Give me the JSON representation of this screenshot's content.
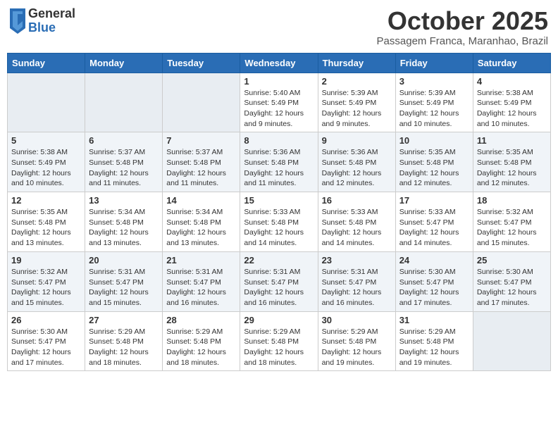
{
  "header": {
    "logo_general": "General",
    "logo_blue": "Blue",
    "month": "October 2025",
    "location": "Passagem Franca, Maranhao, Brazil"
  },
  "days_of_week": [
    "Sunday",
    "Monday",
    "Tuesday",
    "Wednesday",
    "Thursday",
    "Friday",
    "Saturday"
  ],
  "weeks": [
    [
      {
        "day": "",
        "empty": true
      },
      {
        "day": "",
        "empty": true
      },
      {
        "day": "",
        "empty": true
      },
      {
        "day": "1",
        "sunrise": "5:40 AM",
        "sunset": "5:49 PM",
        "daylight": "12 hours and 9 minutes."
      },
      {
        "day": "2",
        "sunrise": "5:39 AM",
        "sunset": "5:49 PM",
        "daylight": "12 hours and 9 minutes."
      },
      {
        "day": "3",
        "sunrise": "5:39 AM",
        "sunset": "5:49 PM",
        "daylight": "12 hours and 10 minutes."
      },
      {
        "day": "4",
        "sunrise": "5:38 AM",
        "sunset": "5:49 PM",
        "daylight": "12 hours and 10 minutes."
      }
    ],
    [
      {
        "day": "5",
        "sunrise": "5:38 AM",
        "sunset": "5:49 PM",
        "daylight": "12 hours and 10 minutes."
      },
      {
        "day": "6",
        "sunrise": "5:37 AM",
        "sunset": "5:48 PM",
        "daylight": "12 hours and 11 minutes."
      },
      {
        "day": "7",
        "sunrise": "5:37 AM",
        "sunset": "5:48 PM",
        "daylight": "12 hours and 11 minutes."
      },
      {
        "day": "8",
        "sunrise": "5:36 AM",
        "sunset": "5:48 PM",
        "daylight": "12 hours and 11 minutes."
      },
      {
        "day": "9",
        "sunrise": "5:36 AM",
        "sunset": "5:48 PM",
        "daylight": "12 hours and 12 minutes."
      },
      {
        "day": "10",
        "sunrise": "5:35 AM",
        "sunset": "5:48 PM",
        "daylight": "12 hours and 12 minutes."
      },
      {
        "day": "11",
        "sunrise": "5:35 AM",
        "sunset": "5:48 PM",
        "daylight": "12 hours and 12 minutes."
      }
    ],
    [
      {
        "day": "12",
        "sunrise": "5:35 AM",
        "sunset": "5:48 PM",
        "daylight": "12 hours and 13 minutes."
      },
      {
        "day": "13",
        "sunrise": "5:34 AM",
        "sunset": "5:48 PM",
        "daylight": "12 hours and 13 minutes."
      },
      {
        "day": "14",
        "sunrise": "5:34 AM",
        "sunset": "5:48 PM",
        "daylight": "12 hours and 13 minutes."
      },
      {
        "day": "15",
        "sunrise": "5:33 AM",
        "sunset": "5:48 PM",
        "daylight": "12 hours and 14 minutes."
      },
      {
        "day": "16",
        "sunrise": "5:33 AM",
        "sunset": "5:48 PM",
        "daylight": "12 hours and 14 minutes."
      },
      {
        "day": "17",
        "sunrise": "5:33 AM",
        "sunset": "5:47 PM",
        "daylight": "12 hours and 14 minutes."
      },
      {
        "day": "18",
        "sunrise": "5:32 AM",
        "sunset": "5:47 PM",
        "daylight": "12 hours and 15 minutes."
      }
    ],
    [
      {
        "day": "19",
        "sunrise": "5:32 AM",
        "sunset": "5:47 PM",
        "daylight": "12 hours and 15 minutes."
      },
      {
        "day": "20",
        "sunrise": "5:31 AM",
        "sunset": "5:47 PM",
        "daylight": "12 hours and 15 minutes."
      },
      {
        "day": "21",
        "sunrise": "5:31 AM",
        "sunset": "5:47 PM",
        "daylight": "12 hours and 16 minutes."
      },
      {
        "day": "22",
        "sunrise": "5:31 AM",
        "sunset": "5:47 PM",
        "daylight": "12 hours and 16 minutes."
      },
      {
        "day": "23",
        "sunrise": "5:31 AM",
        "sunset": "5:47 PM",
        "daylight": "12 hours and 16 minutes."
      },
      {
        "day": "24",
        "sunrise": "5:30 AM",
        "sunset": "5:47 PM",
        "daylight": "12 hours and 17 minutes."
      },
      {
        "day": "25",
        "sunrise": "5:30 AM",
        "sunset": "5:47 PM",
        "daylight": "12 hours and 17 minutes."
      }
    ],
    [
      {
        "day": "26",
        "sunrise": "5:30 AM",
        "sunset": "5:47 PM",
        "daylight": "12 hours and 17 minutes."
      },
      {
        "day": "27",
        "sunrise": "5:29 AM",
        "sunset": "5:48 PM",
        "daylight": "12 hours and 18 minutes."
      },
      {
        "day": "28",
        "sunrise": "5:29 AM",
        "sunset": "5:48 PM",
        "daylight": "12 hours and 18 minutes."
      },
      {
        "day": "29",
        "sunrise": "5:29 AM",
        "sunset": "5:48 PM",
        "daylight": "12 hours and 18 minutes."
      },
      {
        "day": "30",
        "sunrise": "5:29 AM",
        "sunset": "5:48 PM",
        "daylight": "12 hours and 19 minutes."
      },
      {
        "day": "31",
        "sunrise": "5:29 AM",
        "sunset": "5:48 PM",
        "daylight": "12 hours and 19 minutes."
      },
      {
        "day": "",
        "empty": true
      }
    ]
  ],
  "labels": {
    "sunrise": "Sunrise:",
    "sunset": "Sunset:",
    "daylight": "Daylight:"
  }
}
